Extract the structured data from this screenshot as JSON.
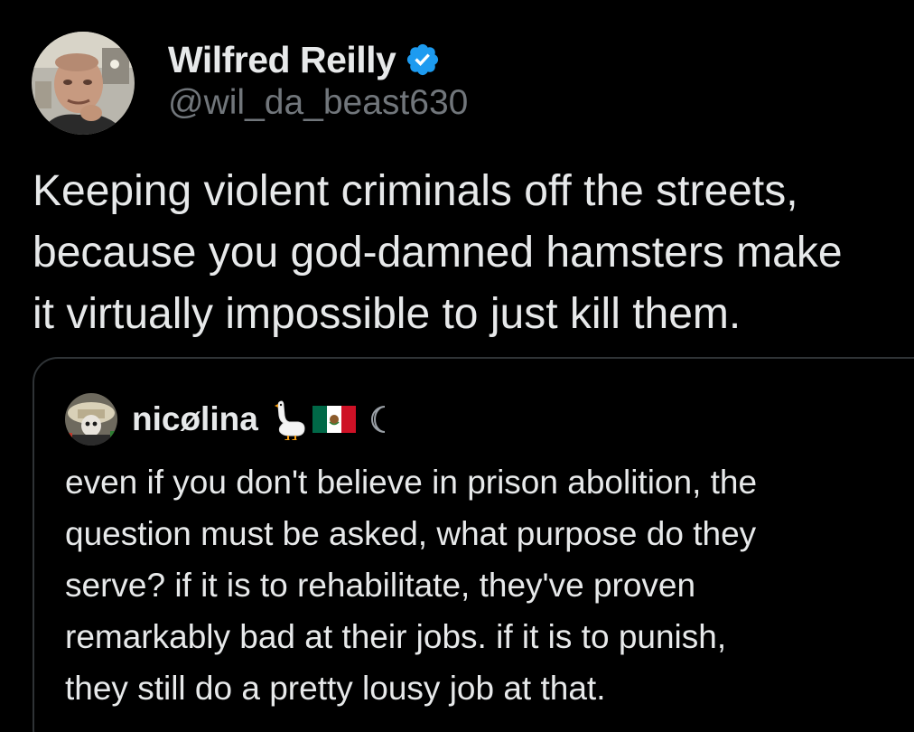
{
  "tweet": {
    "author_name": "Wilfred Reilly",
    "handle": "@wil_da_beast630",
    "verified": true,
    "text_lines": [
      "Keeping violent criminals off the streets,",
      "because you god-damned hamsters make",
      "it virtually impossible to just kill them."
    ]
  },
  "quoted_tweet": {
    "author_name": "nicølina",
    "name_icons": [
      "goose-icon",
      "mexico-flag-icon",
      "moon-icon"
    ],
    "text_lines": [
      "even if you don't believe in prison abolition, the",
      "question must be asked, what purpose do they",
      "serve? if it is to rehabilitate, they've proven",
      "remarkably bad at their jobs. if it is to punish,",
      "they still do a pretty lousy job at that."
    ]
  },
  "colors": {
    "background": "#000000",
    "primary_text": "#e7e9ea",
    "secondary_text": "#71767b",
    "verified_badge": "#1d9bf0",
    "card_border": "#2f3336"
  }
}
